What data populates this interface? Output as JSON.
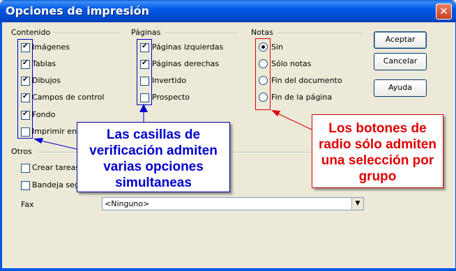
{
  "window": {
    "title": "Opciones de impresión",
    "close_symbol": "✕"
  },
  "groups": {
    "contenido": {
      "label": "Contenido",
      "items": [
        {
          "label": "Imágenes",
          "checked": true
        },
        {
          "label": "Tablas",
          "checked": true
        },
        {
          "label": "Dibujos",
          "checked": true
        },
        {
          "label": "Campos de control",
          "checked": true
        },
        {
          "label": "Fondo",
          "checked": true
        },
        {
          "label": "Imprimir en",
          "checked": false
        }
      ]
    },
    "paginas": {
      "label": "Páginas",
      "items": [
        {
          "label": "Páginas izquierdas",
          "checked": true
        },
        {
          "label": "Páginas derechas",
          "checked": true
        },
        {
          "label": "Invertido",
          "checked": false
        },
        {
          "label": "Prospecto",
          "checked": false
        }
      ]
    },
    "notas": {
      "label": "Notas",
      "items": [
        {
          "label": "Sin",
          "selected": true
        },
        {
          "label": "Sólo notas",
          "selected": false
        },
        {
          "label": "Fin del documento",
          "selected": false
        },
        {
          "label": "Fin de la página",
          "selected": false
        }
      ]
    },
    "otros": {
      "label": "Otros",
      "items": [
        {
          "label": "Crear tareas",
          "checked": false
        },
        {
          "label": "Bandeja seg",
          "checked": false
        }
      ],
      "fax_label": "Fax",
      "fax_value": "<Ninguno>"
    }
  },
  "buttons": {
    "accept": "Aceptar",
    "cancel": "Cancelar",
    "help": "Ayuda"
  },
  "annotations": {
    "blue_text": "Las casillas de verificación admiten varias opciones simultaneas",
    "red_text": "Los botones de radio sólo admiten una selección por grupo",
    "blue_color": "#0000cc",
    "red_color": "#e00000"
  }
}
